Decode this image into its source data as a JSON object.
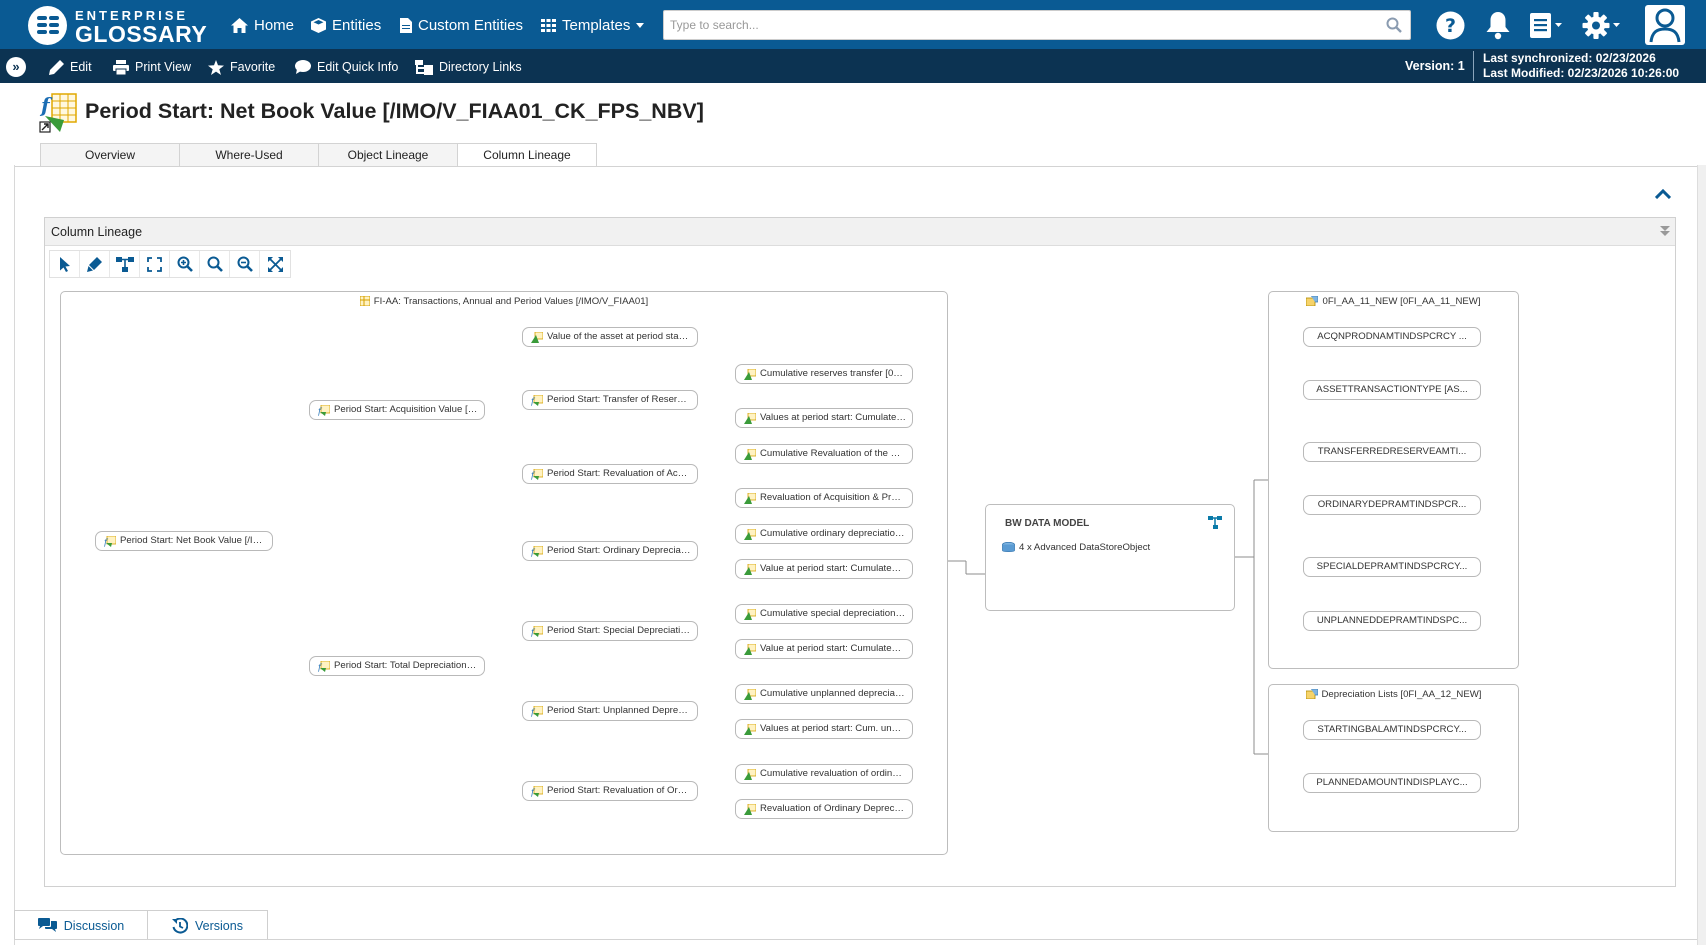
{
  "app": {
    "logo_top": "ENTERPRISE",
    "logo_bottom": "GLOSSARY"
  },
  "nav": {
    "home": "Home",
    "entities": "Entities",
    "custom_entities": "Custom Entities",
    "templates": "Templates",
    "search_placeholder": "Type to search..."
  },
  "toolbar": {
    "edit": "Edit",
    "print_view": "Print View",
    "favorite": "Favorite",
    "edit_quick_info": "Edit Quick Info",
    "directory_links": "Directory Links",
    "version": "Version: 1",
    "last_synchronized": "Last synchronized: 02/23/2026",
    "last_modified": "Last Modified: 02/23/2026 10:26:00"
  },
  "page": {
    "title": "Period Start: Net Book Value [/IMO/V_FIAA01_CK_FPS_NBV]"
  },
  "tabs": [
    "Overview",
    "Where-Used",
    "Object Lineage",
    "Column Lineage"
  ],
  "active_tab": "Column Lineage",
  "panel": {
    "title": "Column Lineage"
  },
  "lineage": {
    "group_left": "FI-AA: Transactions, Annual and Period Values [/IMO/V_FIAA01]",
    "root": "Period Start: Net Book Value [/IM...",
    "level1": [
      "Period Start: Acquisition Value [/I...",
      "Period Start: Total Depreciation [/I..."
    ],
    "level2": [
      "Value of the asset at period start [...",
      "Period Start: Transfer of Reserve...",
      "Period Start: Revaluation of Acqui...",
      "Period Start: Ordinary Depreciati...",
      "Period Start: Special Depreciatio...",
      "Period Start: Unplanned Deprecia...",
      "Period Start: Revaluation of Ordin..."
    ],
    "level3": [
      "Cumulative reserves transfer [0C...",
      "Values at period start: Cumulated...",
      "Cumulative Revaluation of the Re...",
      "Revaluation of Acquisition & Prod...",
      "Cumulative ordinary depreciation ...",
      "Value at period start: Cumulated ...",
      "Cumulative special depreciation [...",
      "Value at period start: Cumulated ...",
      "Cumulative unplanned depreciati...",
      "Values at period start: Cum. unpl...",
      "Cumulative revaluation of ordinar...",
      "Revaluation of Ordinary Deprecia..."
    ],
    "bw_model": {
      "title": "BW DATA MODEL",
      "item": "4 x Advanced DataStoreObject"
    },
    "target_group_1": {
      "label": "0FI_AA_11_NEW [0FI_AA_11_NEW]",
      "fields": [
        "ACQNPRODNAMTINDSPCRCY ...",
        "ASSETTRANSACTIONTYPE [AS...",
        "TRANSFERREDRESERVEAMTI...",
        "ORDINARYDEPRAMTINDSPCR...",
        "SPECIALDEPRAMTINDSPCRCY...",
        "UNPLANNEDDEPRAMTINDSPC..."
      ]
    },
    "target_group_2": {
      "label": "Depreciation Lists [0FI_AA_12_NEW]",
      "fields": [
        "STARTINGBALAMTINDSPCRCY...",
        "PLANNEDAMOUNTINDISPLAYC..."
      ]
    }
  },
  "bottom_tabs": {
    "discussion": "Discussion",
    "versions": "Versions"
  },
  "colors": {
    "topbar": "#0a5a93",
    "toolbar": "#0c3352",
    "accent": "#0a5a93"
  }
}
